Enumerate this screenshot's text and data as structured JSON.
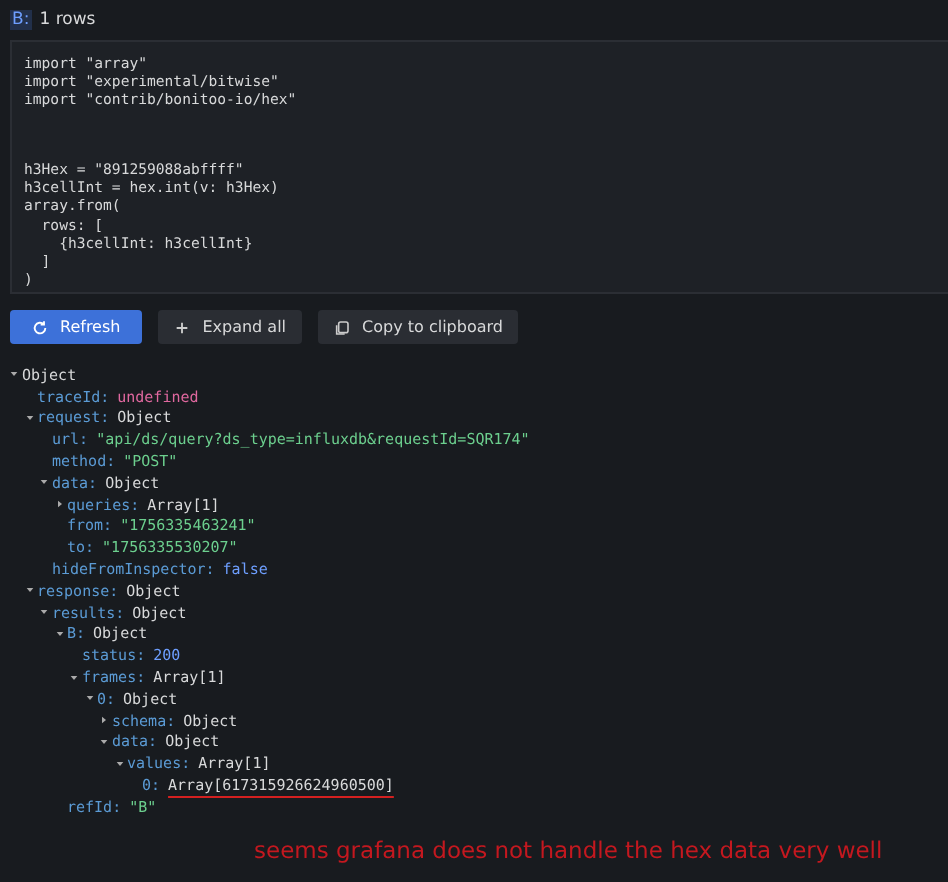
{
  "query_header": {
    "ref": "B:",
    "label": "1 rows"
  },
  "code_blocks": [
    {
      "lines": [
        "import \"array\"",
        "import \"experimental/bitwise\"",
        "import \"contrib/bonitoo-io/hex\""
      ]
    },
    {
      "lines": [
        "h3Hex = \"891259088abffff\"",
        "h3cellInt = hex.int(v: h3Hex)",
        "array.from(",
        "  rows: [",
        "    {h3cellInt: h3cellInt}",
        "  ]",
        ")"
      ]
    }
  ],
  "buttons": [
    {
      "kind": "primary",
      "label": "Refresh"
    },
    {
      "kind": "expand",
      "label": "Expand all"
    },
    {
      "kind": "copy",
      "label": "Copy to clipboard"
    }
  ],
  "tree": [
    {
      "key": "Object",
      "expanded": true,
      "children": [
        {
          "key": "traceId:",
          "value": "undefined",
          "kind": "undefined"
        },
        {
          "key": "request:",
          "value": "Object",
          "kind": "object",
          "expanded": true,
          "children": [
            {
              "key": "url:",
              "value": "\"api/ds/query?ds_type=influxdb&requestId=SQR174\"",
              "kind": "string"
            },
            {
              "key": "method:",
              "value": "\"POST\"",
              "kind": "string"
            },
            {
              "key": "data:",
              "value": "Object",
              "kind": "object",
              "expanded": true,
              "children": [
                {
                  "key": "queries:",
                  "value": "Array[1]",
                  "kind": "object",
                  "expanded": false
                },
                {
                  "key": "from:",
                  "value": "\"1756335463241\"",
                  "kind": "string"
                },
                {
                  "key": "to:",
                  "value": "\"1756335530207\"",
                  "kind": "string"
                }
              ]
            },
            {
              "key": "hideFromInspector:",
              "value": "false",
              "kind": "number"
            }
          ]
        },
        {
          "key": "response:",
          "value": "Object",
          "kind": "object",
          "expanded": true,
          "children": [
            {
              "key": "results:",
              "value": "Object",
              "kind": "object",
              "expanded": true,
              "children": [
                {
                  "key": "B:",
                  "value": "Object",
                  "kind": "object",
                  "expanded": true,
                  "children": [
                    {
                      "key": "status:",
                      "value": "200",
                      "kind": "number"
                    },
                    {
                      "key": "frames:",
                      "value": "Array[1]",
                      "kind": "object",
                      "expanded": true,
                      "children": [
                        {
                          "key": "0:",
                          "value": "Object",
                          "kind": "object",
                          "expanded": true,
                          "children": [
                            {
                              "key": "schema:",
                              "value": "Object",
                              "kind": "object",
                              "expanded": false
                            },
                            {
                              "key": "data:",
                              "value": "Object",
                              "kind": "object",
                              "expanded": true,
                              "children": [
                                {
                                  "key": "values:",
                                  "value": "Array[1]",
                                  "kind": "object",
                                  "expanded": true,
                                  "children": [
                                    {
                                      "key": "0:",
                                      "value": "Array[617315926624960500]",
                                      "kind": "object",
                                      "underlined": true
                                    }
                                  ]
                                }
                              ]
                            }
                          ]
                        }
                      ]
                    }
                  ]
                },
                {
                  "key": "refId:",
                  "value": "\"B\"",
                  "kind": "string"
                }
              ]
            }
          ]
        }
      ]
    }
  ],
  "annotation": "seems grafana does not handle the hex data very well"
}
